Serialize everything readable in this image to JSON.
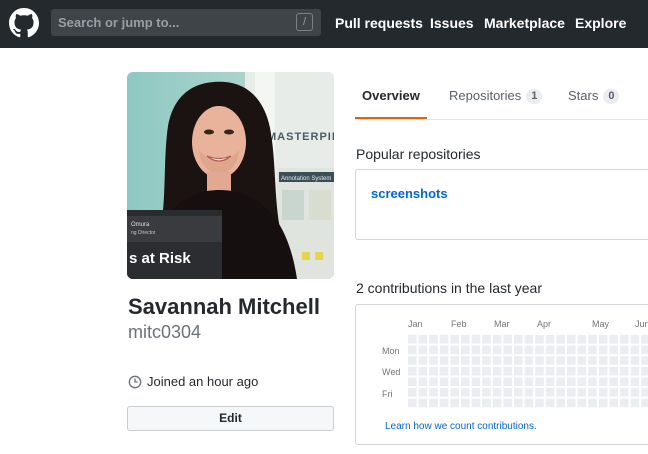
{
  "header": {
    "search_placeholder": "Search or jump to...",
    "search_shortcut": "/",
    "nav": [
      "Pull requests",
      "Issues",
      "Marketplace",
      "Explore"
    ]
  },
  "profile": {
    "full_name": "Savannah Mitchell",
    "username": "mitc0304",
    "joined": "Joined an hour ago",
    "edit_label": "Edit",
    "photo_texts": {
      "sign_word": "MASTERPIE",
      "badge_name": "Omura",
      "badge_title": "ng Director",
      "banner": "s at Risk",
      "poster_subtitle": "Annotation System"
    }
  },
  "tabs": [
    {
      "label": "Overview",
      "selected": true
    },
    {
      "label": "Repositories",
      "count": "1"
    },
    {
      "label": "Stars",
      "count": "0"
    }
  ],
  "popular": {
    "title": "Popular repositories",
    "repos": [
      "screenshots"
    ]
  },
  "contributions": {
    "title": "2 contributions in the last year",
    "months": [
      "Jan",
      "Feb",
      "Mar",
      "Apr",
      "May",
      "Jun"
    ],
    "days": [
      "Mon",
      "Wed",
      "Fri"
    ],
    "learn_link": "Learn how we count contributions."
  },
  "colors": {
    "header_bg": "#24292e",
    "link": "#0366d6",
    "tab_accent": "#e36209",
    "empty_cell": "#ebedf0"
  }
}
